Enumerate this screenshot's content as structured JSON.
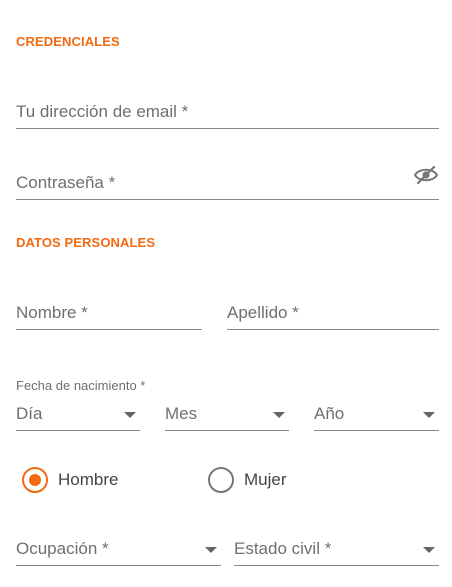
{
  "sections": {
    "credentials": "CREDENCIALES",
    "personal": "DATOS PERSONALES"
  },
  "fields": {
    "email": {
      "placeholder": "Tu dirección de email *"
    },
    "password": {
      "placeholder": "Contraseña *",
      "toggle_icon": "eye-slash-icon"
    },
    "first_name": {
      "placeholder": "Nombre *"
    },
    "last_name": {
      "placeholder": "Apellido *"
    }
  },
  "birthdate": {
    "label": "Fecha de nacimiento *",
    "day": "Día",
    "month": "Mes",
    "year": "Año"
  },
  "gender": {
    "options": [
      {
        "label": "Hombre",
        "selected": true
      },
      {
        "label": "Mujer",
        "selected": false
      }
    ]
  },
  "selects": {
    "occupation": "Ocupación *",
    "marital_status": "Estado civil *"
  },
  "colors": {
    "accent": "#f26a10",
    "line": "#8a8a8a",
    "text": "#6f6f6f"
  }
}
